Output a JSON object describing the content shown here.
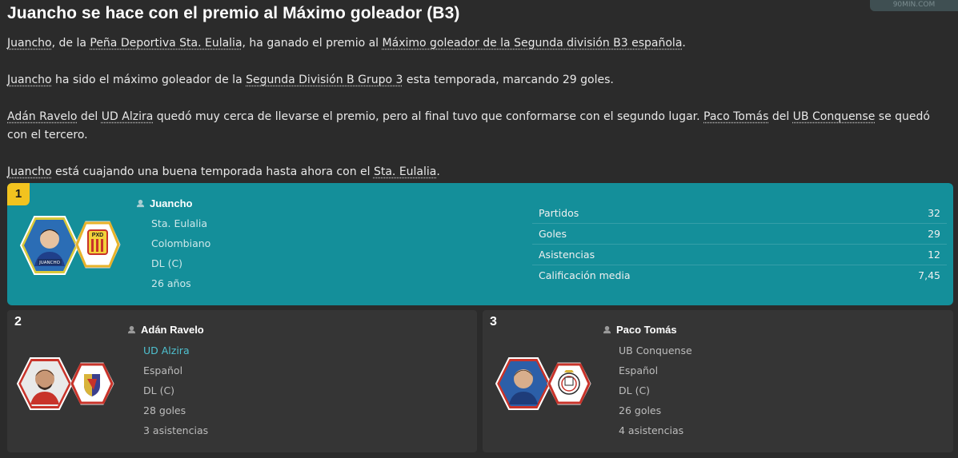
{
  "header": {
    "title": "Juancho se hace con el premio al Máximo goleador (B3)",
    "watermark": "90MIN.COM"
  },
  "article": {
    "p1": {
      "player": "Juancho",
      "t1": ", de la ",
      "club": "Peña Deportiva Sta. Eulalia",
      "t2": ", ha ganado el premio al ",
      "award": "Máximo goleador de la Segunda división B3 española",
      "t3": "."
    },
    "p2": {
      "player": "Juancho",
      "t1": " ha sido el máximo goleador de la ",
      "league": "Segunda División B Grupo 3",
      "t2": " esta temporada, marcando 29 goles."
    },
    "p3": {
      "player2": "Adán Ravelo",
      "t1": " del ",
      "club2": "UD Alzira",
      "t2": " quedó muy cerca de llevarse el premio, pero al final tuvo que conformarse con el segundo lugar. ",
      "player3": "Paco Tomás",
      "t3": " del ",
      "club3": "UB Conquense",
      "t4": " se quedó con el tercero."
    },
    "p4": {
      "player": "Juancho",
      "t1": " está cuajando una buena temporada hasta ahora con el ",
      "club": "Sta. Eulalia",
      "t2": "."
    }
  },
  "winner": {
    "rank": "1",
    "name": "Juancho",
    "club": "Sta. Eulalia",
    "nationality": "Colombiano",
    "position": "DL (C)",
    "age": "26 años",
    "photo_caption": "JUANCHO",
    "club_badge_text": "PXD",
    "stats": [
      {
        "label": "Partidos",
        "value": "32"
      },
      {
        "label": "Goles",
        "value": "29"
      },
      {
        "label": "Asistencias",
        "value": "12"
      },
      {
        "label": "Calificación media",
        "value": "7,45"
      }
    ]
  },
  "runners_up": [
    {
      "rank": "2",
      "name": "Adán Ravelo",
      "club": "UD Alzira",
      "nationality": "Español",
      "position": "DL (C)",
      "goals": "28 goles",
      "assists": "3 asistencias"
    },
    {
      "rank": "3",
      "name": "Paco Tomás",
      "club": "UB Conquense",
      "nationality": "Español",
      "position": "DL (C)",
      "goals": "26 goles",
      "assists": "4 asistencias"
    }
  ],
  "colors": {
    "background": "#2b2b2b",
    "winner_card": "#148f9a",
    "card": "#353535",
    "gold_badge": "#f2c31f",
    "link_teal": "#4fc1d0"
  }
}
